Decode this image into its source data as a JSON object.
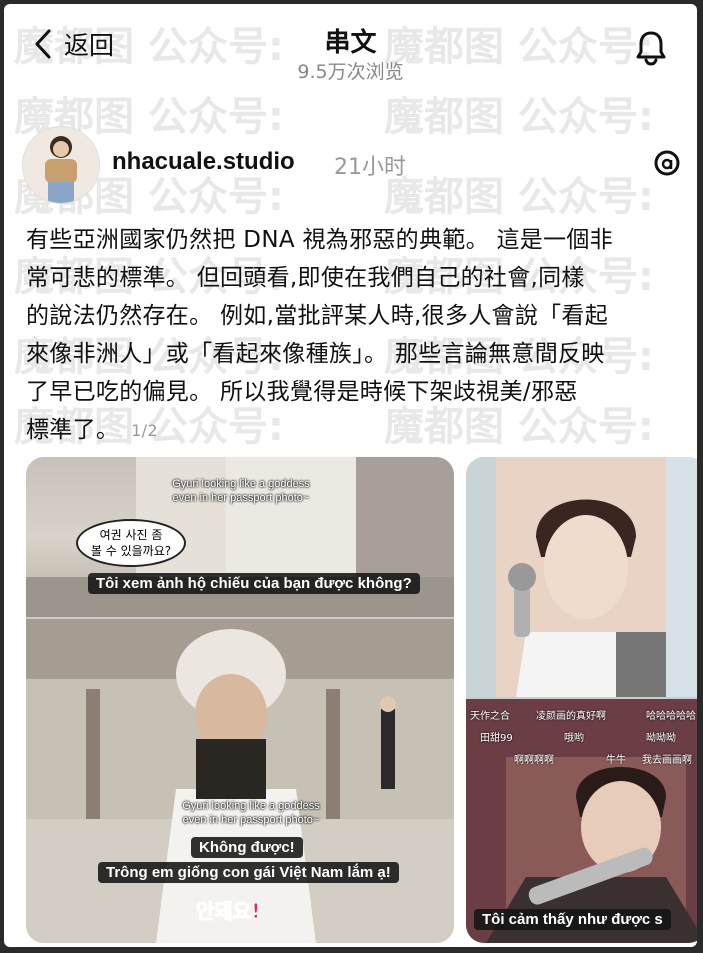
{
  "header": {
    "back_label": "返回",
    "title": "串文",
    "views": "9.5万次浏览"
  },
  "author": {
    "username": "nhacuale.studio",
    "time": "21小时"
  },
  "post": {
    "lines": [
      "有些亞洲國家仍然把 DNA 視為邪惡的典範。 這是一個非",
      "常可悲的標準。 但回頭看,即使在我們自己的社會,同樣",
      "的說法仍然存在。 例如,當批評某人時,很多人會說「看起",
      "來像非洲人」或「看起來像種族」。 那些言論無意間反映",
      "了早已吃的偏見。 所以我覺得是時候下架歧視美/邪惡",
      "標準了。"
    ],
    "pager": "1/2"
  },
  "media_a": {
    "caption_en_1": "Gyuri looking like a goddess\neven in her passport photo~",
    "bubble_ko": "여권 사진 좀\n볼 수 있을까요?",
    "sub_vi_1": "Tôi xem ảnh hộ chiếu của bạn được không?",
    "caption_en_2": "Gyuri looking like a goddess\neven in her passport photo~",
    "sub_vi_2a": "Không được!",
    "sub_vi_2b": "Trông em giống con gái Việt Nam lắm ạ!",
    "red_ko": "안돼요!"
  },
  "media_b": {
    "danmaku": [
      "天作之合",
      "凌颜画的真好啊",
      "哈哈哈哈哈",
      "田甜99",
      "哦哟",
      "呦呦呦",
      "啊啊啊啊",
      "牛牛",
      "我去画画啊"
    ],
    "sub_vi": "Tôi cảm thấy như được s"
  },
  "watermark": "魔都图 公众号:",
  "colors": {
    "background": "#ffffff",
    "frame": "#2a2a2a",
    "text": "#111111",
    "muted": "#888888",
    "accent_pink": "#e2216a"
  },
  "icons": [
    "back-chevron-icon",
    "bell-icon",
    "threads-icon"
  ]
}
